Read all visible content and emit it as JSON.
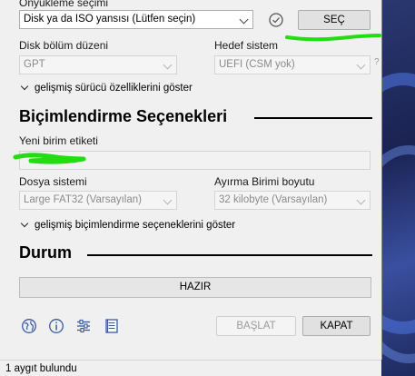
{
  "boot_selection": {
    "label": "Önyükleme seçimi",
    "value": "Disk ya da ISO yansısı (Lütfen seçin)",
    "select_button": "SEÇ"
  },
  "partition_scheme": {
    "label": "Disk bölüm düzeni",
    "value": "GPT"
  },
  "target_system": {
    "label": "Hedef sistem",
    "value": "UEFI (CSM yok)",
    "help": "?"
  },
  "advanced_drive": "gelişmiş sürücü özelliklerini göster",
  "format_section": {
    "title": "Biçimlendirme Seçenekleri"
  },
  "volume_label": {
    "label": "Yeni birim etiketi",
    "value": ""
  },
  "file_system": {
    "label": "Dosya sistemi",
    "value": "Large FAT32 (Varsayılan)"
  },
  "cluster_size": {
    "label": "Ayırma Birimi boyutu",
    "value": "32 kilobyte (Varsayılan)"
  },
  "advanced_format": "gelişmiş biçimlendirme seçeneklerini göster",
  "status_section": {
    "title": "Durum",
    "progress_text": "HAZIR"
  },
  "buttons": {
    "start": "BAŞLAT",
    "close": "KAPAT"
  },
  "status_bar": "1 aygıt bulundu",
  "colors": {
    "highlight_scribble": "#22dd11",
    "accent": "#0078d7"
  }
}
